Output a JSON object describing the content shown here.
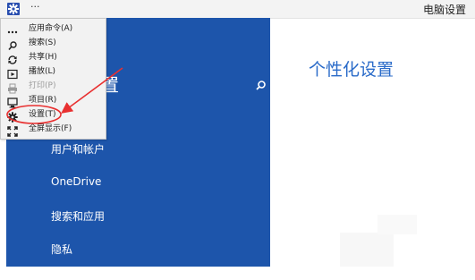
{
  "window": {
    "title": "电脑设置",
    "more_label": "···"
  },
  "blue_panel": {
    "title_fragment": "置",
    "nav_items": [
      "用户和帐户",
      "OneDrive",
      "搜索和应用",
      "隐私"
    ]
  },
  "main": {
    "heading": "个性化设置"
  },
  "app_menu": {
    "items": [
      {
        "icon": "more-icon",
        "label": "应用命令(A)"
      },
      {
        "icon": "search-icon",
        "label": "搜索(S)"
      },
      {
        "icon": "share-icon",
        "label": "共享(H)"
      },
      {
        "icon": "play-icon",
        "label": "播放(L)"
      },
      {
        "icon": "print-icon",
        "label": "打印(P)",
        "disabled": true
      },
      {
        "icon": "project-icon",
        "label": "项目(R)"
      },
      {
        "icon": "gear-icon",
        "label": "设置(T)",
        "highlighted": true
      },
      {
        "icon": "fullscreen-icon",
        "label": "全屏显示(F)"
      }
    ]
  },
  "colors": {
    "panel_blue": "#1d55ab",
    "heading_blue": "#2a6bc9",
    "annotation_red": "#e83030"
  }
}
